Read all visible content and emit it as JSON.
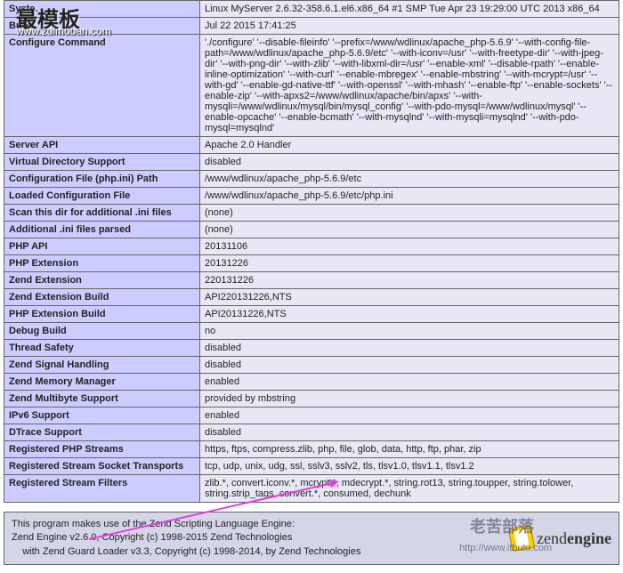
{
  "watermark": {
    "title": "最模板",
    "url": "www.zuimoban.com"
  },
  "rows": [
    {
      "label": "Syste.",
      "value": "Linux MyServer 2.6.32-358.6.1.el6.x86_64 #1 SMP Tue Apr 23 19:29:00 UTC 2013 x86_64"
    },
    {
      "label": "Build",
      "value": "Jul 22 2015 17:41:25"
    },
    {
      "label": "Configure Command",
      "value": "'./configure' '--disable-fileinfo' '--prefix=/www/wdlinux/apache_php-5.6.9' '--with-config-file-path=/www/wdlinux/apache_php-5.6.9/etc' '--with-iconv=/usr' '--with-freetype-dir' '--with-jpeg-dir' '--with-png-dir' '--with-zlib' '--with-libxml-dir=/usr' '--enable-xml' '--disable-rpath' '--enable-inline-optimization' '--with-curl' '--enable-mbregex' '--enable-mbstring' '--with-mcrypt=/usr' '--with-gd' '--enable-gd-native-ttf' '--with-openssl' '--with-mhash' '--enable-ftp' '--enable-sockets' '--enable-zip' '--with-apxs2=/www/wdlinux/apache/bin/apxs' '--with-mysqli=/www/wdlinux/mysql/bin/mysql_config' '--with-pdo-mysql=/www/wdlinux/mysql' '--enable-opcache' '--enable-bcmath' '--with-mysqlnd' '--with-mysqli=mysqlnd' '--with-pdo-mysql=mysqlnd'"
    },
    {
      "label": "Server API",
      "value": "Apache 2.0 Handler"
    },
    {
      "label": "Virtual Directory Support",
      "value": "disabled"
    },
    {
      "label": "Configuration File (php.ini) Path",
      "value": "/www/wdlinux/apache_php-5.6.9/etc"
    },
    {
      "label": "Loaded Configuration File",
      "value": "/www/wdlinux/apache_php-5.6.9/etc/php.ini"
    },
    {
      "label": "Scan this dir for additional .ini files",
      "value": "(none)"
    },
    {
      "label": "Additional .ini files parsed",
      "value": "(none)"
    },
    {
      "label": "PHP API",
      "value": "20131106"
    },
    {
      "label": "PHP Extension",
      "value": "20131226"
    },
    {
      "label": "Zend Extension",
      "value": "220131226"
    },
    {
      "label": "Zend Extension Build",
      "value": "API220131226,NTS"
    },
    {
      "label": "PHP Extension Build",
      "value": "API20131226,NTS"
    },
    {
      "label": "Debug Build",
      "value": "no"
    },
    {
      "label": "Thread Safety",
      "value": "disabled"
    },
    {
      "label": "Zend Signal Handling",
      "value": "disabled"
    },
    {
      "label": "Zend Memory Manager",
      "value": "enabled"
    },
    {
      "label": "Zend Multibyte Support",
      "value": "provided by mbstring"
    },
    {
      "label": "IPv6 Support",
      "value": "enabled"
    },
    {
      "label": "DTrace Support",
      "value": "disabled"
    },
    {
      "label": "Registered PHP Streams",
      "value": "https, ftps, compress.zlib, php, file, glob, data, http, ftp, phar, zip"
    },
    {
      "label": "Registered Stream Socket Transports",
      "value": "tcp, udp, unix, udg, ssl, sslv3, sslv2, tls, tlsv1.0, tlsv1.1, tlsv1.2"
    },
    {
      "label": "Registered Stream Filters",
      "value": "zlib.*, convert.iconv.*, mcrypt.*, mdecrypt.*, string.rot13, string.toupper, string.tolower, string.strip_tags, convert.*, consumed, dechunk"
    }
  ],
  "footer": {
    "line1": "This program makes use of the Zend Scripting Language Engine:",
    "line2": "Zend Engine v2.6.0, Copyright (c) 1998-2015 Zend Technologies",
    "line3": "    with Zend Guard Loader v3.3, Copyright (c) 1998-2014, by Zend Technologies",
    "logo_light": "zend",
    "logo_bold": "engine"
  },
  "wm_right": {
    "title": "老苦部落",
    "url": "http://www.itbulu.com"
  }
}
